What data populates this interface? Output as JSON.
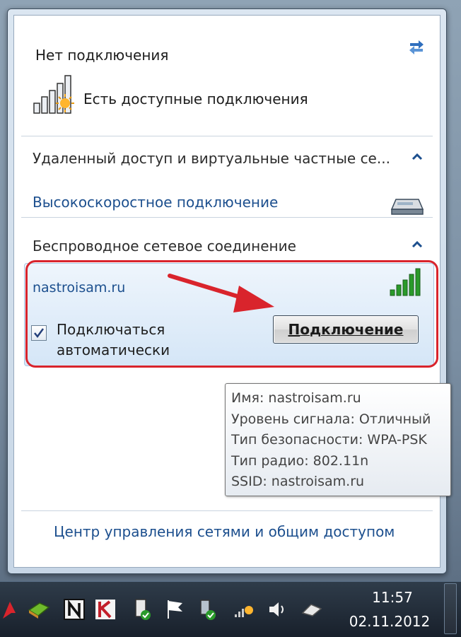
{
  "panel": {
    "status_title": "Нет подключения",
    "status_available": "Есть доступные подключения",
    "section_vpn": "Удаленный доступ и виртуальные частные се...",
    "link_highspeed": "Высокоскоростное подключение",
    "section_wireless": "Беспроводное сетевое соединение",
    "network": {
      "name": "nastroisam.ru",
      "auto_connect_label": "Подключаться автоматически",
      "auto_connect_checked": true,
      "connect_button": "Подключение"
    },
    "tooltip": [
      "Имя: nastroisam.ru",
      "Уровень сигнала: Отличный",
      "Тип безопасности: WPA-PSK",
      "Тип радио: 802.11n",
      "SSID: nastroisam.ru"
    ],
    "link_center": "Центр управления сетями и общим доступом"
  },
  "taskbar": {
    "time": "11:57",
    "date": "02.11.2012"
  },
  "colors": {
    "link": "#1c4f8e",
    "highlight": "#d9242c",
    "signal_green": "#2a9a2a"
  },
  "icons": {
    "refresh": "refresh-icon",
    "signal_weak": "wifi-signal-available-icon",
    "modem": "modem-icon",
    "signal_full": "wifi-signal-full-icon"
  }
}
